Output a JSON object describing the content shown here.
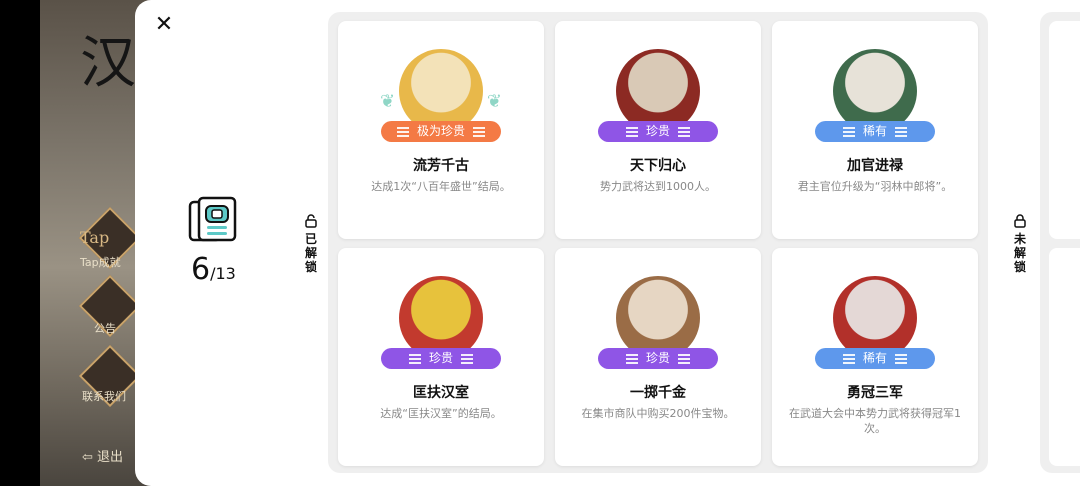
{
  "background": {
    "title_char": "汉",
    "buttons": [
      {
        "label": "Tap成就",
        "sub": "Tap"
      },
      {
        "label": "公告"
      },
      {
        "label": "联系我们"
      }
    ],
    "exit_label": "退出"
  },
  "panel": {
    "close_symbol": "✕",
    "progress": {
      "current": "6",
      "total": "/13"
    },
    "unlocked_label": "已解锁",
    "locked_label": "未解锁"
  },
  "achievements": [
    {
      "title": "流芳千古",
      "desc": "达成1次“八百年盛世”结局。",
      "rarity": "极为珍贵",
      "tier": "legend",
      "avatar_colors": [
        "#f3e2b8",
        "#e8b84a",
        "#c9b28c"
      ]
    },
    {
      "title": "天下归心",
      "desc": "势力武将达到1000人。",
      "rarity": "珍贵",
      "tier": "epic",
      "avatar_colors": [
        "#d9c9b6",
        "#8c2a23",
        "#3c2a25"
      ]
    },
    {
      "title": "加官进禄",
      "desc": "君主官位升级为“羽林中郎将”。",
      "rarity": "稀有",
      "tier": "rare",
      "avatar_colors": [
        "#e7e2d8",
        "#3f6b4c",
        "#2a2a2a"
      ]
    },
    {
      "title": "匡扶汉室",
      "desc": "达成“匡扶汉室”的结局。",
      "rarity": "珍贵",
      "tier": "epic",
      "avatar_colors": [
        "#e7c23c",
        "#c23a2e",
        "#2c2c2c"
      ]
    },
    {
      "title": "一掷千金",
      "desc": "在集市商队中购买200件宝物。",
      "rarity": "珍贵",
      "tier": "epic",
      "avatar_colors": [
        "#e6d6c3",
        "#9a6c46",
        "#5a3d2b"
      ]
    },
    {
      "title": "勇冠三军",
      "desc": "在武道大会中本势力武将获得冠军1次。",
      "rarity": "稀有",
      "tier": "rare",
      "avatar_colors": [
        "#e4d8d6",
        "#b2302a",
        "#3a2a2a"
      ]
    }
  ]
}
